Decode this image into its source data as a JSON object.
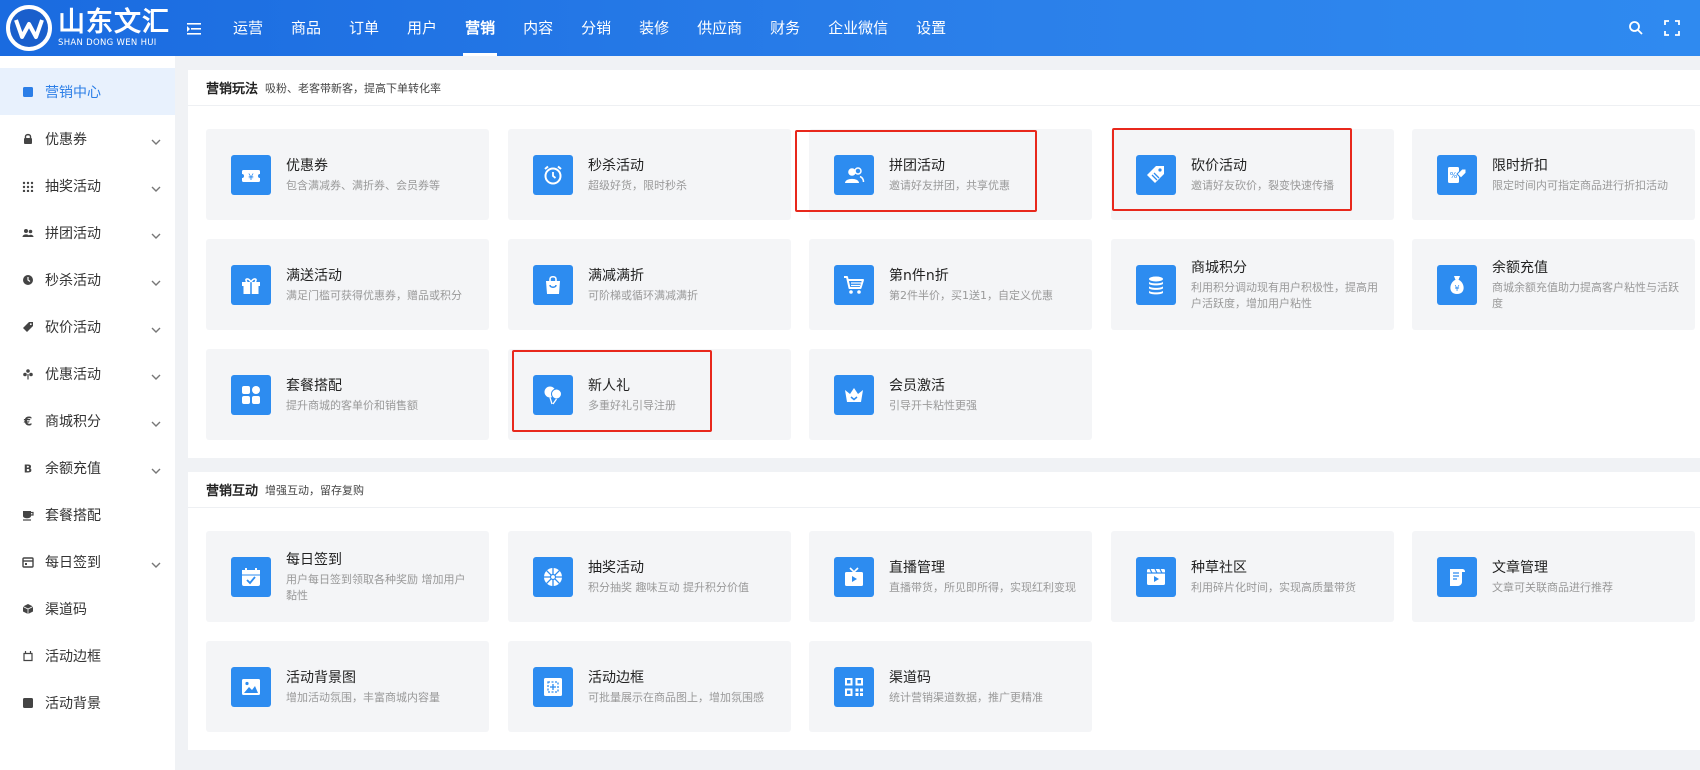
{
  "logo": {
    "cn": "山东文汇",
    "en": "SHAN DONG WEN HUI"
  },
  "nav": [
    "运营",
    "商品",
    "订单",
    "用户",
    "营销",
    "内容",
    "分销",
    "装修",
    "供应商",
    "财务",
    "企业微信",
    "设置"
  ],
  "nav_active": "营销",
  "sidebar": [
    {
      "label": "营销中心",
      "icon": "square-icon",
      "chevron": false
    },
    {
      "label": "优惠券",
      "icon": "lock-icon",
      "chevron": true
    },
    {
      "label": "抽奖活动",
      "icon": "grid-icon",
      "chevron": true
    },
    {
      "label": "拼团活动",
      "icon": "group-icon",
      "chevron": true
    },
    {
      "label": "秒杀活动",
      "icon": "clock-icon",
      "chevron": true
    },
    {
      "label": "砍价活动",
      "icon": "tag-icon",
      "chevron": true
    },
    {
      "label": "优惠活动",
      "icon": "flower-icon",
      "chevron": true
    },
    {
      "label": "商城积分",
      "icon": "euro-icon",
      "chevron": true
    },
    {
      "label": "余额充值",
      "icon": "bitcoin-icon",
      "chevron": true
    },
    {
      "label": "套餐搭配",
      "icon": "cup-icon",
      "chevron": false
    },
    {
      "label": "每日签到",
      "icon": "calendar-icon",
      "chevron": true
    },
    {
      "label": "渠道码",
      "icon": "cube-icon",
      "chevron": false
    },
    {
      "label": "活动边框",
      "icon": "frame-icon",
      "chevron": false
    },
    {
      "label": "活动背景",
      "icon": "square-icon",
      "chevron": false
    }
  ],
  "section1": {
    "title": "营销玩法",
    "subtitle": "吸粉、老客带新客，提高下单转化率",
    "cards": [
      {
        "title": "优惠券",
        "desc": "包含满减券、满折券、会员券等",
        "icon": "coupon-icon"
      },
      {
        "title": "秒杀活动",
        "desc": "超级好货，限时秒杀",
        "icon": "alarm-clock-icon"
      },
      {
        "title": "拼团活动",
        "desc": "邀请好友拼团，共享优惠",
        "icon": "user-group-icon"
      },
      {
        "title": "砍价活动",
        "desc": "邀请好友砍价，裂变快速传播",
        "icon": "price-tag-icon"
      },
      {
        "title": "限时折扣",
        "desc": "限定时间内可指定商品进行折扣活动",
        "icon": "discount-icon"
      },
      {
        "title": "满送活动",
        "desc": "满足门槛可获得优惠券，赠品或积分",
        "icon": "gift-icon"
      },
      {
        "title": "满减满折",
        "desc": "可阶梯或循环满减满折",
        "icon": "bag-icon"
      },
      {
        "title": "第n件n折",
        "desc": "第2件半价，买1送1，自定义优惠",
        "icon": "cart-icon"
      },
      {
        "title": "商城积分",
        "desc": "利用积分调动现有用户积极性，提高用户活跃度，增加用户粘性",
        "icon": "coins-icon"
      },
      {
        "title": "余额充值",
        "desc": "商城余额充值助力提高客户粘性与活跃度",
        "icon": "money-bag-icon"
      },
      {
        "title": "套餐搭配",
        "desc": "提升商城的客单价和销售额",
        "icon": "apps-icon"
      },
      {
        "title": "新人礼",
        "desc": "多重好礼引导注册",
        "icon": "balloon-icon"
      },
      {
        "title": "会员激活",
        "desc": "引导开卡粘性更强",
        "icon": "crown-icon"
      }
    ]
  },
  "section2": {
    "title": "营销互动",
    "subtitle": "增强互动，留存复购",
    "cards": [
      {
        "title": "每日签到",
        "desc": "用户每日签到领取各种奖励 增加用户黏性",
        "icon": "calendar-check-icon"
      },
      {
        "title": "抽奖活动",
        "desc": "积分抽奖 趣味互动 提升积分价值",
        "icon": "wheel-icon"
      },
      {
        "title": "直播管理",
        "desc": "直播带货，所见即所得，实现红利变现",
        "icon": "live-tv-icon"
      },
      {
        "title": "种草社区",
        "desc": "利用碎片化时间，实现高质量带货",
        "icon": "video-icon"
      },
      {
        "title": "文章管理",
        "desc": "文章可关联商品进行推荐",
        "icon": "scroll-icon"
      },
      {
        "title": "活动背景图",
        "desc": "增加活动氛围，丰富商城内容量",
        "icon": "image-icon"
      },
      {
        "title": "活动边框",
        "desc": "可批量展示在商品图上，增加氛围感",
        "icon": "frame-icon"
      },
      {
        "title": "渠道码",
        "desc": "统计营销渠道数据，推广更精准",
        "icon": "qrcode-icon"
      }
    ]
  },
  "colors": {
    "header": "#2b80ea",
    "accent": "#2d8cf0",
    "highlight": "#e8281c"
  }
}
